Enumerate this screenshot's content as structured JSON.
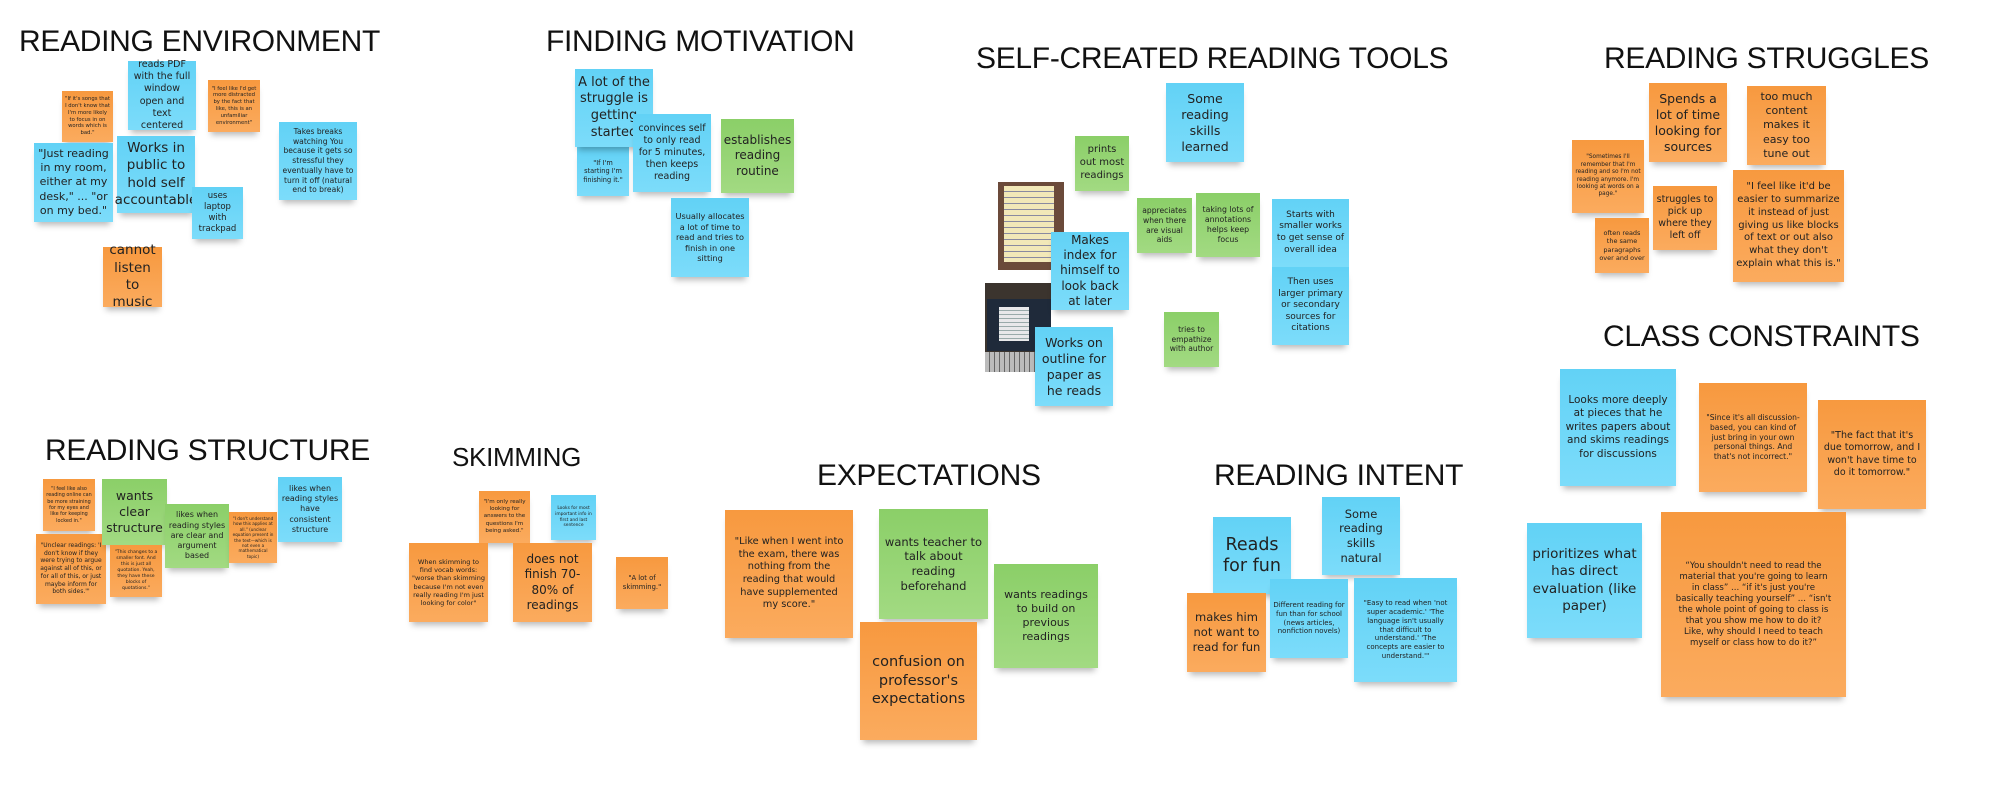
{
  "colors": {
    "blue_note": "#6ad5f6",
    "orange_note": "#f9a24f",
    "green_note": "#97d57a",
    "text": "#222222"
  },
  "clusters": [
    {
      "title": "READING ENVIRONMENT",
      "notes": [
        {
          "text": "\"If it's songs that I don't know that I'm more likely to focus in on words which is bad.\"",
          "color": "orange"
        },
        {
          "text": "reads PDF with the full window open and text centered",
          "color": "blue"
        },
        {
          "text": "\"I feel like I'd get more distracted by the fact that like, this is an unfamiliar environment\"",
          "color": "orange"
        },
        {
          "text": "Takes breaks watching You because it gets so stressful they eventually have to turn it off (natural end to break)",
          "color": "blue"
        },
        {
          "text": "\"Just reading in my room, either at my desk,\" ... \"or on my bed.\"",
          "color": "blue"
        },
        {
          "text": "Works in public to hold self accountable",
          "color": "blue"
        },
        {
          "text": "uses laptop with trackpad",
          "color": "blue"
        },
        {
          "text": "cannot listen to music",
          "color": "orange"
        }
      ]
    },
    {
      "title": "FINDING MOTIVATION",
      "notes": [
        {
          "text": "A lot of the struggle is getting started",
          "color": "blue"
        },
        {
          "text": "\"If I'm starting I'm finishing it.\"",
          "color": "blue"
        },
        {
          "text": "convinces self to only read for 5 minutes, then keeps reading",
          "color": "blue"
        },
        {
          "text": "establishes reading routine",
          "color": "green"
        },
        {
          "text": "Usually allocates a lot of time to read and tries to finish in one sitting",
          "color": "blue"
        }
      ]
    },
    {
      "title": "SELF-CREATED READING TOOLS",
      "notes": [
        {
          "text": "Some reading skills learned",
          "color": "blue"
        },
        {
          "text": "prints out most readings",
          "color": "green"
        },
        {
          "text": "Makes index for himself to look back at later",
          "color": "blue"
        },
        {
          "text": "Works on outline for paper as he reads",
          "color": "blue"
        },
        {
          "text": "appreciates when there are visual aids",
          "color": "green"
        },
        {
          "text": "taking lots of annotations helps keep focus",
          "color": "green"
        },
        {
          "text": "Starts with smaller works to get sense of overall idea",
          "color": "blue"
        },
        {
          "text": "Then uses larger primary or secondary sources for citations",
          "color": "blue"
        },
        {
          "text": "tries to empathize with author",
          "color": "green"
        }
      ],
      "photos": [
        "handwritten-index-photo",
        "laptop-outline-photo"
      ]
    },
    {
      "title": "READING STRUGGLES",
      "notes": [
        {
          "text": "Spends a lot of time looking for sources",
          "color": "orange"
        },
        {
          "text": "too much content makes it easy too tune out",
          "color": "orange"
        },
        {
          "text": "\"Sometimes I'll remember that I'm reading and so I'm not reading anymore. I'm looking at words on a page.\"",
          "color": "orange"
        },
        {
          "text": "struggles to pick up where they left off",
          "color": "orange"
        },
        {
          "text": "often reads the same paragraphs over and over",
          "color": "orange"
        },
        {
          "text": "\"I feel like it'd be easier to summarize it instead of just giving us like blocks of text or out also what they don't explain what this is.\"",
          "color": "orange"
        }
      ]
    },
    {
      "title": "CLASS CONSTRAINTS",
      "notes": [
        {
          "text": "Looks more deeply at pieces that he writes papers about and skims readings for discussions",
          "color": "blue"
        },
        {
          "text": "\"Since it's all discussion-based, you can kind of just bring in your own personal things. And that's not incorrect.\"",
          "color": "orange"
        },
        {
          "text": "\"The fact that it's due tomorrow, and I won't have time to do it tomorrow.\"",
          "color": "orange"
        },
        {
          "text": "prioritizes what has direct evaluation (like paper)",
          "color": "blue"
        },
        {
          "text": "“You shouldn't need to read the material that you're going to learn in class” ... “if it's just you're basically teaching yourself” ... “isn't the whole point of going to class is that you show me how to do it? Like, why should I need to teach myself or class how to do it?”",
          "color": "orange"
        }
      ]
    },
    {
      "title": "READING STRUCTURE",
      "notes": [
        {
          "text": "\"I feel like also reading online can be more straining for my eyes and like for keeping locked in.\"",
          "color": "orange"
        },
        {
          "text": "\"Unclear readings: 'I don't know if they were trying to argue against all of this, or for all of this, or just maybe inform for both sides.'\"",
          "color": "orange"
        },
        {
          "text": "wants clear structure",
          "color": "green"
        },
        {
          "text": "\"This changes to a smaller font. And this is just all quotation. Yeah, they have these blocks of quotations.\"",
          "color": "orange"
        },
        {
          "text": "likes when reading styles are clear and argument based",
          "color": "green"
        },
        {
          "text": "\"I don't understand how this applies at all.\" (unclear equation present in the text—which is not even a mathematical topic)",
          "color": "orange"
        },
        {
          "text": "likes when reading styles have consistent structure",
          "color": "blue"
        }
      ]
    },
    {
      "title": "SKIMMING",
      "notes": [
        {
          "text": "\"I'm only really looking for answers to the questions I'm being asked.\"",
          "color": "orange"
        },
        {
          "text": "Looks for most important info in first and last sentence",
          "color": "blue"
        },
        {
          "text": "When skimming to find vocab words: \"worse than skimming because I'm not even really reading I'm just looking for color\"",
          "color": "orange"
        },
        {
          "text": "does not finish 70-80% of readings",
          "color": "orange"
        },
        {
          "text": "\"A lot of skimming.\"",
          "color": "orange"
        }
      ]
    },
    {
      "title": "EXPECTATIONS",
      "notes": [
        {
          "text": "\"Like when I went into the exam, there was nothing from the reading that would have supplemented my score.\"",
          "color": "orange"
        },
        {
          "text": "wants teacher to talk about reading beforehand",
          "color": "green"
        },
        {
          "text": "wants readings to build on previous readings",
          "color": "green"
        },
        {
          "text": "confusion on professor's expectations",
          "color": "orange"
        }
      ]
    },
    {
      "title": "READING INTENT",
      "notes": [
        {
          "text": "Reads for fun",
          "color": "blue"
        },
        {
          "text": "Some reading skills natural",
          "color": "blue"
        },
        {
          "text": "makes him not want to read for fun",
          "color": "orange"
        },
        {
          "text": "Different reading for fun than for school (news articles, nonfiction novels)",
          "color": "blue"
        },
        {
          "text": "\"Easy to read when 'not super academic.' 'The language isn't usually that difficult to understand.' 'The concepts are easier to understand.'\"",
          "color": "blue"
        }
      ]
    }
  ]
}
